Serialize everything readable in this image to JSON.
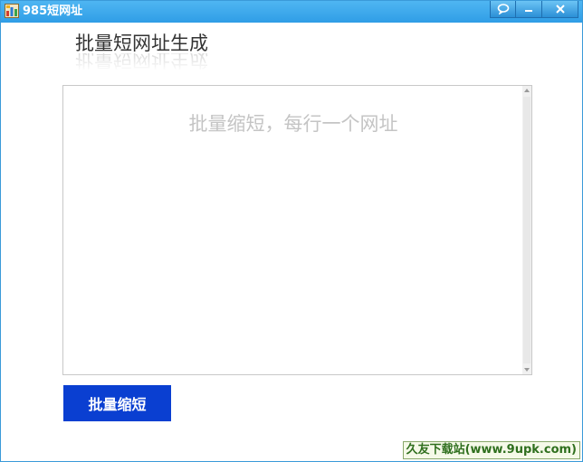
{
  "window": {
    "title": "985短网址",
    "controls": {
      "help_icon": "speech-bubble-icon",
      "minimize_icon": "minimize-icon",
      "close_icon": "close-icon"
    }
  },
  "main": {
    "heading": "批量短网址生成",
    "textarea": {
      "placeholder": "批量缩短，每行一个网址",
      "value": ""
    },
    "batch_button_label": "批量缩短"
  },
  "watermark": "久友下载站(www.9upk.com)",
  "colors": {
    "titlebar": "#2f9de6",
    "button": "#0a3fd1",
    "placeholder": "#c4c4c4",
    "heading": "#333333"
  }
}
